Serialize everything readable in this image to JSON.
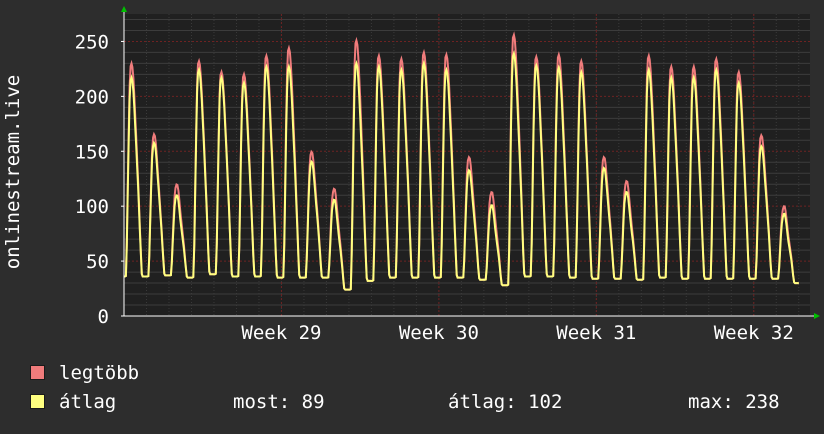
{
  "chart_data": {
    "type": "line",
    "ylabel": "onlinestream.live",
    "ylim": [
      0,
      275
    ],
    "yticks": [
      0,
      50,
      100,
      150,
      200,
      250
    ],
    "xlabels": [
      "Week 29",
      "Week 30",
      "Week 31",
      "Week 32"
    ],
    "x_unit": "day",
    "x_label_days": [
      7,
      14,
      21,
      28
    ],
    "xlim_days": [
      0,
      30.5
    ],
    "grid": true,
    "colors": {
      "max": "#f07c7c",
      "avg": "#ffff80",
      "axis": "#ffffff",
      "grid": "#6e2222",
      "arrow": "#00c000",
      "background": "#202020"
    },
    "daily_peaks": {
      "max": [
        228,
        163,
        117,
        230,
        220,
        218,
        235,
        242,
        147,
        113,
        249,
        235,
        232,
        238,
        236,
        142,
        110,
        254,
        234,
        236,
        230,
        142,
        120,
        235,
        225,
        225,
        232,
        220,
        162,
        97
      ],
      "avg": [
        215,
        155,
        107,
        222,
        215,
        210,
        225,
        225,
        138,
        103,
        228,
        225,
        222,
        228,
        222,
        130,
        98,
        237,
        226,
        224,
        220,
        132,
        110,
        222,
        215,
        215,
        222,
        210,
        152,
        90
      ],
      "troughs": [
        36,
        37,
        35,
        38,
        36,
        36,
        35,
        35,
        35,
        24,
        32,
        35,
        35,
        35,
        35,
        33,
        28,
        36,
        36,
        35,
        34,
        34,
        33,
        35,
        34,
        34,
        34,
        34,
        34,
        30
      ]
    },
    "series": [
      {
        "name": "legtöbb",
        "color": "#f07c7c"
      },
      {
        "name": "átlag",
        "color": "#ffff80"
      }
    ]
  },
  "legend": {
    "max_label": "legtöbb",
    "avg_label": "átlag",
    "now_text": "most: 89",
    "avg_text": "átlag: 102",
    "max_text": "max: 238"
  }
}
